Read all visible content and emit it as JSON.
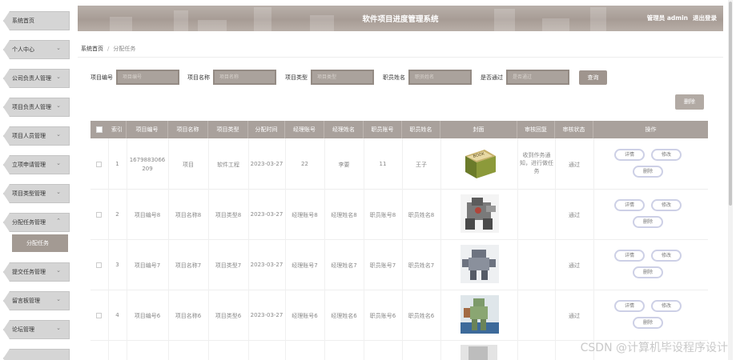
{
  "header": {
    "title": "软件项目进度管理系统",
    "role_user": "管理员 admin",
    "logout": "退出登录"
  },
  "sidebar": {
    "items": [
      {
        "label": "系统首页",
        "chev": ""
      },
      {
        "label": "个人中心",
        "chev": "⌄"
      },
      {
        "label": "公司负责人管理",
        "chev": "⌄"
      },
      {
        "label": "项目负责人管理",
        "chev": "⌄"
      },
      {
        "label": "项目人员管理",
        "chev": "⌄"
      },
      {
        "label": "立项申请管理",
        "chev": "⌄"
      },
      {
        "label": "项目类型管理",
        "chev": "⌄"
      },
      {
        "label": "分配任务管理",
        "chev": "⌃"
      },
      {
        "label": "提交任务管理",
        "chev": "⌄"
      },
      {
        "label": "留言板管理",
        "chev": "⌄"
      },
      {
        "label": "论坛管理",
        "chev": "⌄"
      }
    ],
    "sub_item": "分配任务"
  },
  "breadcrumb": {
    "home": "系统首页",
    "sep": "/",
    "current": "分配任务"
  },
  "search": {
    "fields": [
      {
        "label": "项目编号",
        "placeholder": "项目编号"
      },
      {
        "label": "项目名称",
        "placeholder": "项目名称"
      },
      {
        "label": "项目类型",
        "placeholder": "项目类型"
      },
      {
        "label": "职员姓名",
        "placeholder": "职员姓名"
      },
      {
        "label": "是否通过",
        "placeholder": "是否通过"
      }
    ],
    "query_button": "查询",
    "delete_button": "删除"
  },
  "table": {
    "headers": [
      "索引",
      "项目编号",
      "项目名称",
      "项目类型",
      "分配时间",
      "经理账号",
      "经理姓名",
      "职员账号",
      "职员姓名",
      "封面",
      "审核回复",
      "审核状态",
      "操作"
    ],
    "rows": [
      {
        "idx": "1",
        "code": "1679883066 209",
        "name": "项目",
        "type": "软件工程",
        "time": "2023-03-27",
        "mgr_acc": "22",
        "mgr_name": "李要",
        "emp_acc": "11",
        "emp_name": "王子",
        "cover": "book",
        "reply": "收到作务通知，进行做任务",
        "status": "通过"
      },
      {
        "idx": "2",
        "code": "项目编号8",
        "name": "项目名称8",
        "type": "项目类型8",
        "time": "2023-03-27",
        "mgr_acc": "经理账号8",
        "mgr_name": "经理姓名8",
        "emp_acc": "职员账号8",
        "emp_name": "职员姓名8",
        "cover": "robot-gray",
        "reply": "",
        "status": "通过"
      },
      {
        "idx": "3",
        "code": "项目编号7",
        "name": "项目名称7",
        "type": "项目类型7",
        "time": "2023-03-27",
        "mgr_acc": "经理账号7",
        "mgr_name": "经理姓名7",
        "emp_acc": "职员账号7",
        "emp_name": "职员姓名7",
        "cover": "robot-blue",
        "reply": "",
        "status": "通过"
      },
      {
        "idx": "4",
        "code": "项目编号6",
        "name": "项目名称6",
        "type": "项目类型6",
        "time": "2023-03-27",
        "mgr_acc": "经理账号6",
        "mgr_name": "经理姓名6",
        "emp_acc": "职员账号6",
        "emp_name": "职员姓名6",
        "cover": "robot-green",
        "reply": "",
        "status": "通过"
      }
    ],
    "ops": {
      "detail": "详情",
      "edit": "修改",
      "delete": "删除"
    }
  },
  "watermark": "CSDN @计算机毕设程序设计"
}
